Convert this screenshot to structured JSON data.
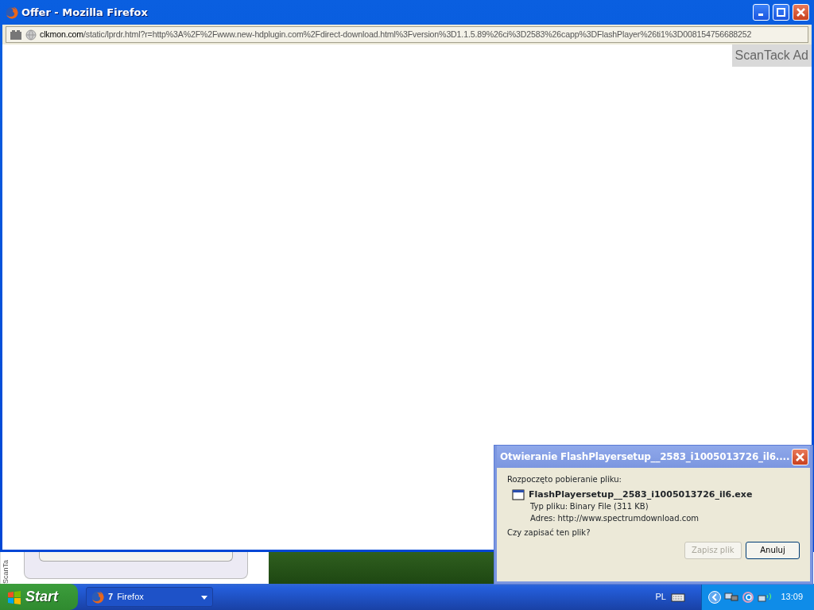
{
  "window": {
    "title": "Offer - Mozilla Firefox"
  },
  "address_bar": {
    "domain": "clkmon.com",
    "path": "/static/lprdr.html?r=http%3A%2F%2Fwww.new-hdplugin.com%2Fdirect-download.html%3Fversion%3D1.1.5.89%26ci%3D2583%26capp%3DFlashPlayer%26ti1%3D008154756688252"
  },
  "ad_label": "ScanTack Ad",
  "background_window": {
    "side_label": "ScanTa"
  },
  "dialog": {
    "title": "Otwieranie FlashPlayersetup__2583_i1005013726_il6....",
    "intro": "Rozpoczęto pobieranie pliku:",
    "file_name": "FlashPlayersetup__2583_i1005013726_il6.exe",
    "details": [
      {
        "label": "Typ pliku:",
        "value": "Binary File (311 KB)"
      },
      {
        "label": "Adres:",
        "value": "http://www.spectrumdownload.com"
      }
    ],
    "question": "Czy zapisać ten plik?",
    "buttons": [
      {
        "label": "Zapisz plik",
        "disabled": true
      },
      {
        "label": "Anuluj",
        "disabled": false
      }
    ]
  },
  "taskbar": {
    "start": "Start",
    "tasks": [
      {
        "count": "7",
        "label": "Firefox"
      }
    ],
    "language": "PL",
    "clock": "13:09"
  }
}
